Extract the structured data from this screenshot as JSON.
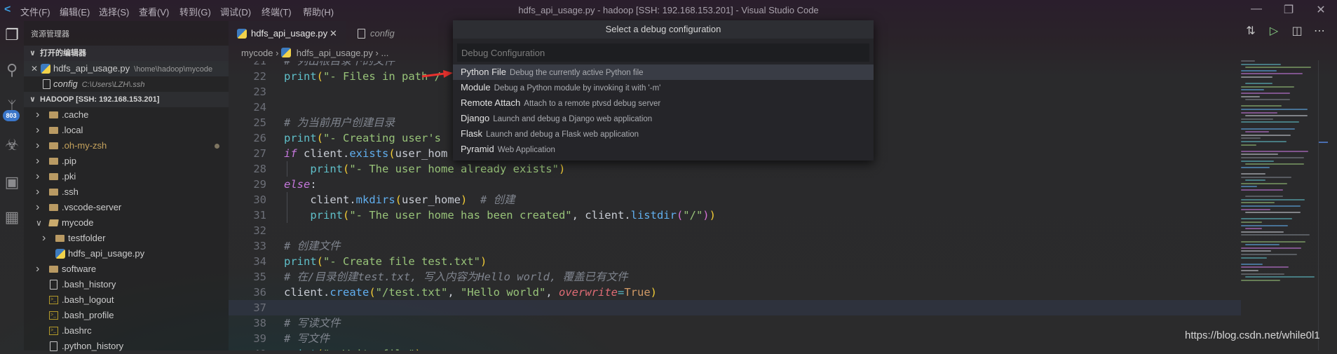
{
  "window": {
    "title": "hdfs_api_usage.py - hadoop [SSH: 192.168.153.201] - Visual Studio Code",
    "controls": [
      "minimize",
      "restore",
      "close"
    ]
  },
  "menu": [
    "文件(F)",
    "编辑(E)",
    "选择(S)",
    "查看(V)",
    "转到(G)",
    "调试(D)",
    "终端(T)",
    "帮助(H)"
  ],
  "activity": {
    "scm_badge": "803",
    "icons": [
      "files-icon",
      "search-icon",
      "source-control-icon",
      "debug-icon",
      "remote-explorer-icon",
      "extensions-icon"
    ]
  },
  "sidebar": {
    "title": "资源管理器",
    "open_editors": {
      "header": "打开的编辑器",
      "items": [
        {
          "name": "hdfs_api_usage.py",
          "path": "\\home\\hadoop\\mycode"
        },
        {
          "name": "config",
          "path": "C:\\Users\\LZH\\.ssh"
        }
      ]
    },
    "workspace": {
      "header": "HADOOP [SSH: 192.168.153.201]",
      "items": [
        {
          "name": ".cache",
          "type": "folder"
        },
        {
          "name": ".local",
          "type": "folder"
        },
        {
          "name": ".oh-my-zsh",
          "type": "folder",
          "modified": true
        },
        {
          "name": ".pip",
          "type": "folder"
        },
        {
          "name": ".pki",
          "type": "folder"
        },
        {
          "name": ".ssh",
          "type": "folder"
        },
        {
          "name": ".vscode-server",
          "type": "folder"
        },
        {
          "name": "mycode",
          "type": "folder-open"
        },
        {
          "name": "testfolder",
          "type": "folder",
          "depth": 1
        },
        {
          "name": "hdfs_api_usage.py",
          "type": "python",
          "depth": 1
        },
        {
          "name": "software",
          "type": "folder"
        },
        {
          "name": ".bash_history",
          "type": "file"
        },
        {
          "name": ".bash_logout",
          "type": "terminal"
        },
        {
          "name": ".bash_profile",
          "type": "terminal"
        },
        {
          "name": ".bashrc",
          "type": "terminal"
        },
        {
          "name": ".python_history",
          "type": "file"
        }
      ]
    }
  },
  "tabs": [
    {
      "label": "hdfs_api_usage.py",
      "active": true
    },
    {
      "label": "config",
      "active": false
    }
  ],
  "breadcrumb": [
    "mycode",
    "hdfs_api_usage.py",
    "..."
  ],
  "editor": {
    "current_line": 37,
    "lines": [
      {
        "n": "21",
        "tokens": [
          {
            "t": "# 列出根目录下的文件",
            "c": "cm"
          }
        ]
      },
      {
        "n": "22",
        "tokens": [
          {
            "t": "print",
            "c": "fn"
          },
          {
            "t": "(",
            "c": "br"
          },
          {
            "t": "\"- Files in path /",
            "c": "st"
          }
        ]
      },
      {
        "n": "23",
        "tokens": []
      },
      {
        "n": "24",
        "tokens": []
      },
      {
        "n": "25",
        "tokens": [
          {
            "t": "# 为当前用户创建目录",
            "c": "cm"
          }
        ]
      },
      {
        "n": "26",
        "tokens": [
          {
            "t": "print",
            "c": "fn"
          },
          {
            "t": "(",
            "c": "br"
          },
          {
            "t": "\"- Creating user's",
            "c": "st"
          }
        ]
      },
      {
        "n": "27",
        "tokens": [
          {
            "t": "if",
            "c": "kw"
          },
          {
            "t": " client.",
            "c": "pl"
          },
          {
            "t": "exists",
            "c": "me"
          },
          {
            "t": "(",
            "c": "br"
          },
          {
            "t": "user_hom",
            "c": "pl"
          }
        ]
      },
      {
        "n": "28",
        "tokens": [
          {
            "t": "    ",
            "c": "pl"
          },
          {
            "t": "print",
            "c": "fn"
          },
          {
            "t": "(",
            "c": "br"
          },
          {
            "t": "\"- The user home already exists\"",
            "c": "st"
          },
          {
            "t": ")",
            "c": "br"
          }
        ]
      },
      {
        "n": "29",
        "tokens": [
          {
            "t": "else",
            "c": "kw"
          },
          {
            "t": ":",
            "c": "pl"
          }
        ]
      },
      {
        "n": "30",
        "tokens": [
          {
            "t": "    client.",
            "c": "pl"
          },
          {
            "t": "mkdirs",
            "c": "me"
          },
          {
            "t": "(",
            "c": "br"
          },
          {
            "t": "user_home",
            "c": "pl"
          },
          {
            "t": ")",
            "c": "br"
          },
          {
            "t": "  # 创建",
            "c": "cm"
          }
        ]
      },
      {
        "n": "31",
        "tokens": [
          {
            "t": "    ",
            "c": "pl"
          },
          {
            "t": "print",
            "c": "fn"
          },
          {
            "t": "(",
            "c": "br"
          },
          {
            "t": "\"- The user home has been created\"",
            "c": "st"
          },
          {
            "t": ", client.",
            "c": "pl"
          },
          {
            "t": "listdir",
            "c": "me"
          },
          {
            "t": "(",
            "c": "br2"
          },
          {
            "t": "\"/\"",
            "c": "st"
          },
          {
            "t": ")",
            "c": "br2"
          },
          {
            "t": ")",
            "c": "br"
          }
        ]
      },
      {
        "n": "32",
        "tokens": []
      },
      {
        "n": "33",
        "tokens": [
          {
            "t": "# 创建文件",
            "c": "cm"
          }
        ]
      },
      {
        "n": "34",
        "tokens": [
          {
            "t": "print",
            "c": "fn"
          },
          {
            "t": "(",
            "c": "br"
          },
          {
            "t": "\"- Create file test.txt\"",
            "c": "st"
          },
          {
            "t": ")",
            "c": "br"
          }
        ]
      },
      {
        "n": "35",
        "tokens": [
          {
            "t": "# 在/目录创建test.txt, 写入内容为Hello world, 覆盖已有文件",
            "c": "cm"
          }
        ]
      },
      {
        "n": "36",
        "tokens": [
          {
            "t": "client.",
            "c": "pl"
          },
          {
            "t": "create",
            "c": "me"
          },
          {
            "t": "(",
            "c": "br"
          },
          {
            "t": "\"/test.txt\"",
            "c": "st"
          },
          {
            "t": ", ",
            "c": "pl"
          },
          {
            "t": "\"Hello world\"",
            "c": "st"
          },
          {
            "t": ", ",
            "c": "pl"
          },
          {
            "t": "overwrite",
            "c": "pa"
          },
          {
            "t": "=",
            "c": "op"
          },
          {
            "t": "True",
            "c": "co"
          },
          {
            "t": ")",
            "c": "br"
          }
        ]
      },
      {
        "n": "37",
        "tokens": []
      },
      {
        "n": "38",
        "tokens": [
          {
            "t": "# 写读文件",
            "c": "cm"
          }
        ]
      },
      {
        "n": "39",
        "tokens": [
          {
            "t": "# 写文件",
            "c": "cm"
          }
        ]
      },
      {
        "n": "40",
        "tokens": [
          {
            "t": "print",
            "c": "fn"
          },
          {
            "t": "(",
            "c": "br"
          },
          {
            "t": "\"- Write file\"",
            "c": "st"
          },
          {
            "t": ")",
            "c": "br"
          }
        ]
      }
    ]
  },
  "toolbar": {
    "icons": [
      "open-changes-icon",
      "run-icon",
      "split-editor-icon",
      "more-actions-icon"
    ],
    "run_color": "#89d185"
  },
  "quick_pick": {
    "title": "Select a debug configuration",
    "placeholder": "Debug Configuration",
    "options": [
      {
        "name": "Python File",
        "desc": "Debug the currently active Python file",
        "selected": true
      },
      {
        "name": "Module",
        "desc": "Debug a Python module by invoking it with '-m'"
      },
      {
        "name": "Remote Attach",
        "desc": "Attach to a remote ptvsd debug server"
      },
      {
        "name": "Django",
        "desc": "Launch and debug a Django web application"
      },
      {
        "name": "Flask",
        "desc": "Launch and debug a Flask web application"
      },
      {
        "name": "Pyramid",
        "desc": "Web Application"
      }
    ]
  },
  "annotation": {
    "arrow_color": "#e8322e"
  },
  "watermark": "https://blog.csdn.net/while0l1"
}
